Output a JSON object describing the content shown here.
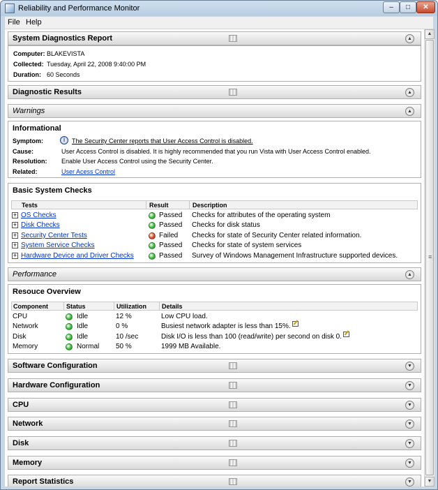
{
  "window": {
    "title": "Reliability and Performance Monitor",
    "min": "–",
    "max": "□",
    "close": "✕"
  },
  "menu": {
    "file": "File",
    "help": "Help"
  },
  "report": {
    "title": "System Diagnostics Report",
    "computer_label": "Computer:",
    "computer": "BLAKEVISTA",
    "collected_label": "Collected:",
    "collected": "Tuesday, April 22, 2008 9:40:00 PM",
    "duration_label": "Duration:",
    "duration": "60 Seconds"
  },
  "sections": {
    "diagnostic_results": "Diagnostic Results",
    "warnings": "Warnings",
    "performance": "Performance",
    "software": "Software Configuration",
    "hardware": "Hardware Configuration",
    "cpu": "CPU",
    "network": "Network",
    "disk": "Disk",
    "memory": "Memory",
    "report_stats": "Report Statistics"
  },
  "informational": {
    "title": "Informational",
    "rows": [
      {
        "label": "Symptom:",
        "value": "The Security Center reports that User Access Control is disabled."
      },
      {
        "label": "Cause:",
        "value": "User Access Control is disabled. It is highly recommended that you run Vista with User Access Control enabled."
      },
      {
        "label": "Resolution:",
        "value": "Enable User Access Control using the Security Center."
      },
      {
        "label": "Related:",
        "value": "User Acess Control"
      }
    ]
  },
  "basic_checks": {
    "title": "Basic System Checks",
    "headers": [
      "Tests",
      "Result",
      "Description"
    ],
    "rows": [
      {
        "test": "OS Checks",
        "result": "Passed",
        "status": "pass",
        "description": "Checks for attributes of the operating system"
      },
      {
        "test": "Disk Checks",
        "result": "Passed",
        "status": "pass",
        "description": "Checks for disk status"
      },
      {
        "test": "Security Center Tests",
        "result": "Failed",
        "status": "fail",
        "description": "Checks for state of Security Center related information."
      },
      {
        "test": "System Service Checks",
        "result": "Passed",
        "status": "pass",
        "description": "Checks for state of system services"
      },
      {
        "test": "Hardware Device and Driver Checks",
        "result": "Passed",
        "status": "pass",
        "description": "Survey of Windows Management Infrastructure supported devices."
      }
    ]
  },
  "resource_overview": {
    "title": "Resouce Overview",
    "headers": [
      "Component",
      "Status",
      "Utilization",
      "Details"
    ],
    "rows": [
      {
        "component": "CPU",
        "status": "Idle",
        "utilization": "12 %",
        "details": "Low CPU load.",
        "edit": false
      },
      {
        "component": "Network",
        "status": "Idle",
        "utilization": "0 %",
        "details": "Busiest network adapter is less than 15%.",
        "edit": true
      },
      {
        "component": "Disk",
        "status": "Idle",
        "utilization": "10 /sec",
        "details": "Disk I/O is less than 100 (read/write) per second on disk 0.",
        "edit": true
      },
      {
        "component": "Memory",
        "status": "Normal",
        "utilization": "50 %",
        "details": "1999 MB Available.",
        "edit": false
      }
    ]
  },
  "colors": {
    "pass": "#2fb52f",
    "fail": "#d2401e"
  }
}
